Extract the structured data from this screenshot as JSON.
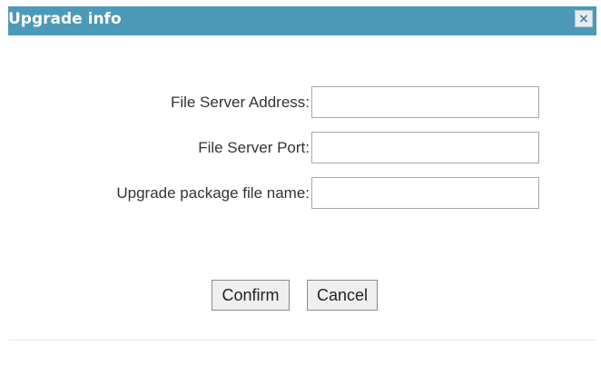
{
  "dialog": {
    "title": "Upgrade info",
    "close_icon": "close-icon",
    "title_bar_color": "#4d9ab8"
  },
  "form": {
    "fields": [
      {
        "label": "File Server Address:",
        "value": "",
        "placeholder": ""
      },
      {
        "label": "File Server Port:",
        "value": "",
        "placeholder": ""
      },
      {
        "label": "Upgrade package file name:",
        "value": "",
        "placeholder": ""
      }
    ]
  },
  "buttons": {
    "confirm_label": "Confirm",
    "cancel_label": "Cancel"
  }
}
